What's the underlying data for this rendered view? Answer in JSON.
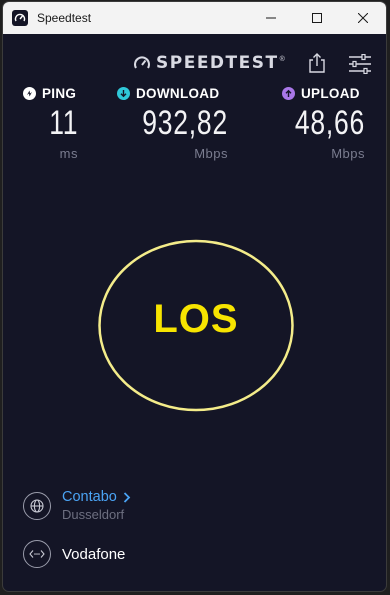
{
  "window": {
    "title": "Speedtest"
  },
  "header": {
    "logo_text": "SPEEDTEST",
    "logo_mark": "®"
  },
  "metrics": {
    "ping": {
      "label": "PING",
      "value": "11",
      "unit": "ms",
      "icon": "ping-icon",
      "color": "#ffffff"
    },
    "download": {
      "label": "DOWNLOAD",
      "value": "932,82",
      "unit": "Mbps",
      "icon": "download-arrow-icon",
      "color": "#2fc8d8"
    },
    "upload": {
      "label": "UPLOAD",
      "value": "48,66",
      "unit": "Mbps",
      "icon": "upload-arrow-icon",
      "color": "#a977e8"
    }
  },
  "go_button": {
    "label": "LOS",
    "color": "#f7e400"
  },
  "server": {
    "host": "Contabo",
    "location": "Dusseldorf",
    "icon": "globe-icon"
  },
  "provider": {
    "name": "Vodafone",
    "icon": "connection-icon"
  },
  "colors": {
    "background": "#141526",
    "link": "#4aa3f4"
  }
}
